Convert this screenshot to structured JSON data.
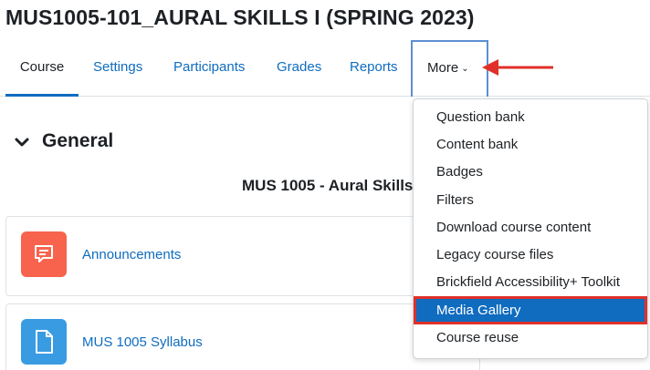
{
  "page": {
    "title": "MUS1005-101_AURAL SKILLS I (SPRING 2023)"
  },
  "nav": {
    "tabs": [
      {
        "label": "Course"
      },
      {
        "label": "Settings"
      },
      {
        "label": "Participants"
      },
      {
        "label": "Grades"
      },
      {
        "label": "Reports"
      }
    ],
    "more_label": "More"
  },
  "section": {
    "title": "General",
    "summary_title": "MUS 1005 - Aural Skills I"
  },
  "activities": [
    {
      "label": "Announcements",
      "icon": "forum-icon",
      "icon_color": "#f7634d"
    },
    {
      "label": "MUS 1005 Syllabus",
      "icon": "file-icon",
      "icon_color": "#399be2"
    }
  ],
  "dropdown": {
    "items": [
      {
        "label": "Question bank"
      },
      {
        "label": "Content bank"
      },
      {
        "label": "Badges"
      },
      {
        "label": "Filters"
      },
      {
        "label": "Download course content"
      },
      {
        "label": "Legacy course files"
      },
      {
        "label": "Brickfield Accessibility+ Toolkit"
      },
      {
        "label": "Media Gallery",
        "highlighted": true
      },
      {
        "label": "Course reuse"
      }
    ]
  },
  "colors": {
    "link": "#0f6cbf",
    "highlight_bg": "#0f6cbf",
    "annotation_red": "#e0302a",
    "more_outline": "#5b8fd1"
  }
}
